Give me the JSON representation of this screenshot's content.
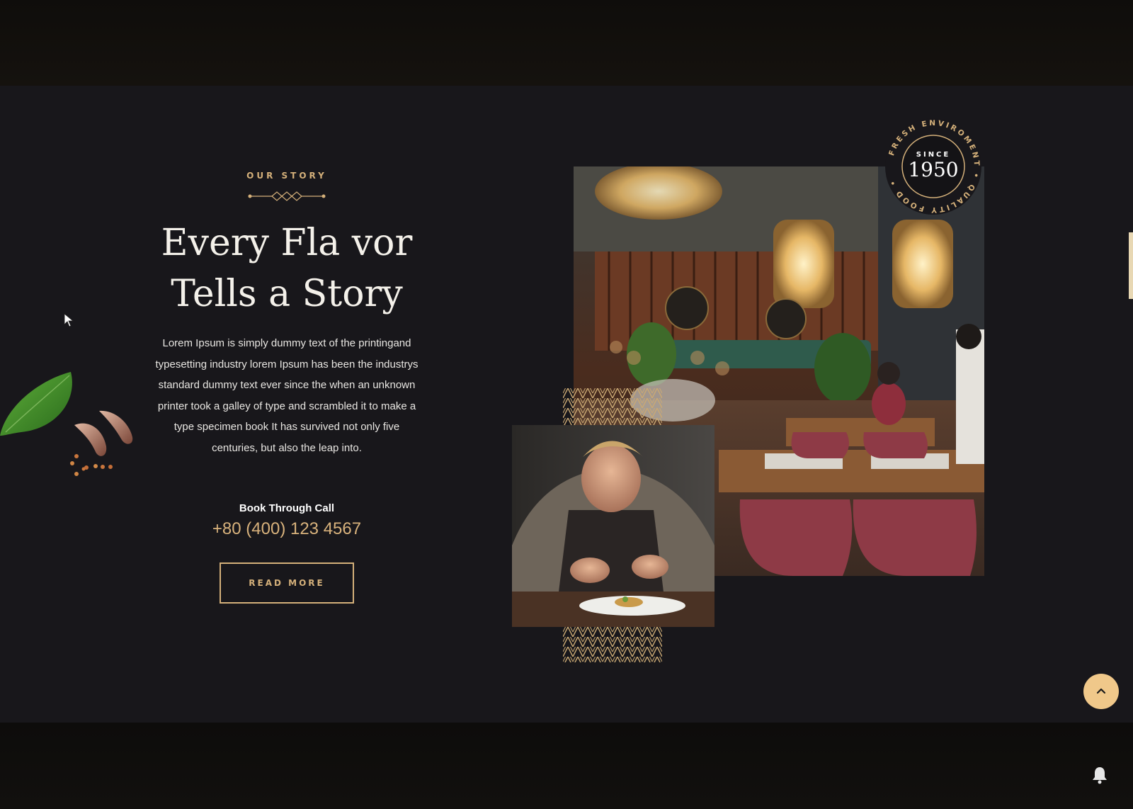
{
  "story": {
    "eyebrow": "OUR STORY",
    "title_line1": "Every Fla vor",
    "title_line2": "Tells a Story",
    "body": "Lorem Ipsum is simply dummy text of the printingand typesetting industry lorem Ipsum has been the industrys standard dummy text ever since the when an unknown printer took a galley of type and scrambled it to make a type specimen book It has survived not only five centuries, but also the leap into.",
    "book_label": "Book Through Call",
    "phone": "+80 (400) 123 4567",
    "button_label": "READ MORE"
  },
  "badge": {
    "since_label": "SINCE",
    "year": "1950",
    "ring_text": "FRESH ENVIROMENT • QUALITY FOOD •"
  },
  "colors": {
    "accent_gold": "#d4b07a",
    "background": "#18171b",
    "scroll_button": "#f0c88a"
  },
  "icons": {
    "scroll_top": "chevron-up-icon",
    "notifications": "bell-icon"
  }
}
